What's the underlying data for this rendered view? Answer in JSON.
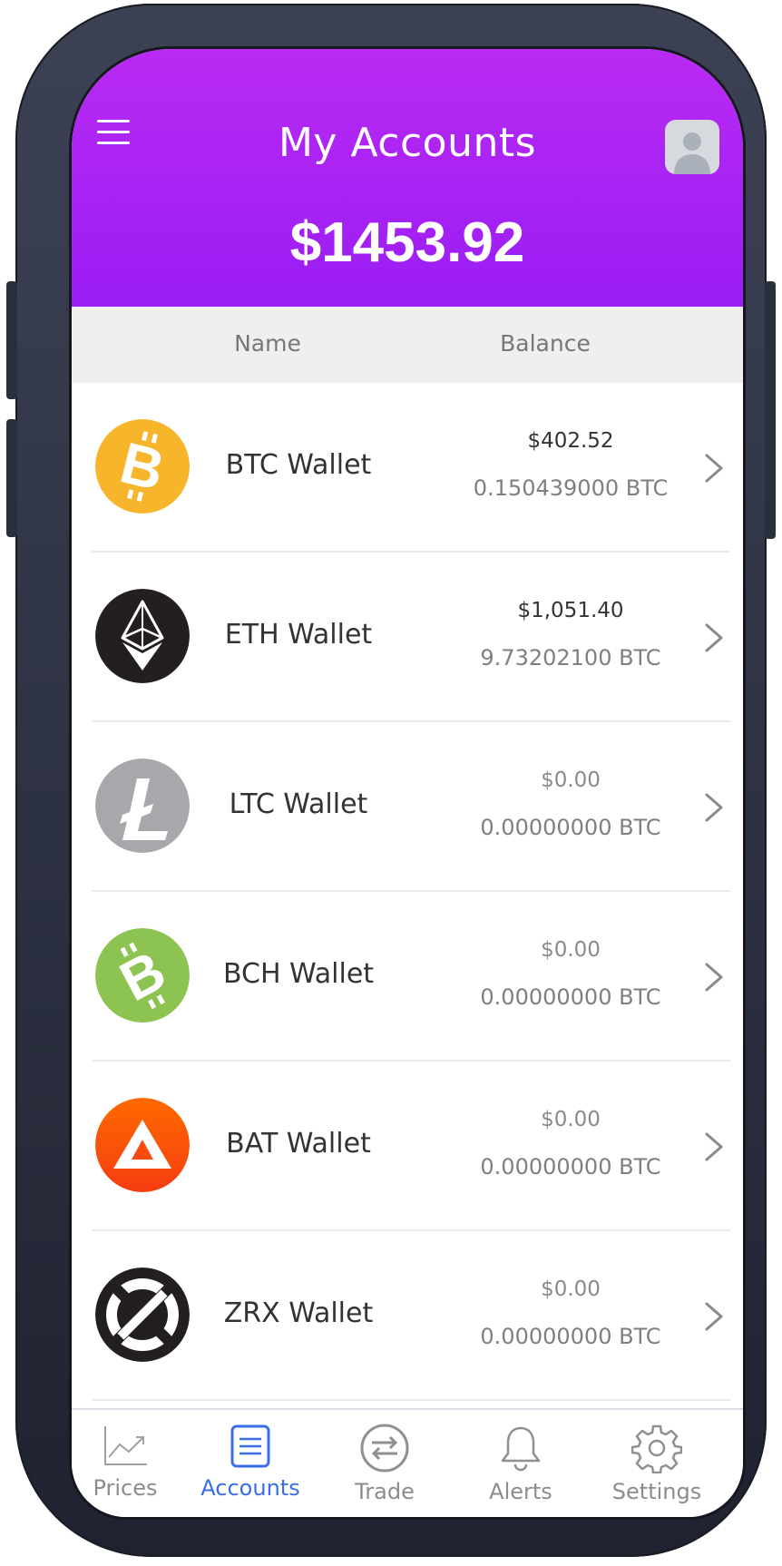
{
  "header": {
    "title": "My Accounts",
    "total": "$1453.92",
    "background_color": "#a822f4"
  },
  "columns": {
    "name": "Name",
    "balance": "Balance"
  },
  "wallets": [
    {
      "name": "BTC Wallet",
      "usd": "$402.52",
      "btc": "0.150439000 BTC",
      "icon": "bitcoin-icon",
      "color": "#f7b52c"
    },
    {
      "name": "ETH Wallet",
      "usd": "$1,051.40",
      "btc": "9.73202100 BTC",
      "icon": "ethereum-icon",
      "color": "#231f20"
    },
    {
      "name": "LTC Wallet",
      "usd": "$0.00",
      "btc": "0.00000000 BTC",
      "icon": "litecoin-icon",
      "color": "#a6a8ab"
    },
    {
      "name": "BCH Wallet",
      "usd": "$0.00",
      "btc": "0.00000000 BTC",
      "icon": "bitcoin-cash-icon",
      "color": "#8dc351"
    },
    {
      "name": "BAT Wallet",
      "usd": "$0.00",
      "btc": "0.00000000 BTC",
      "icon": "bat-icon",
      "color": "#ff5000"
    },
    {
      "name": "ZRX Wallet",
      "usd": "$0.00",
      "btc": "0.00000000 BTC",
      "icon": "zrx-icon",
      "color": "#231f20"
    }
  ],
  "tabs": [
    {
      "label": "Prices",
      "icon": "chart-icon",
      "active": false
    },
    {
      "label": "Accounts",
      "icon": "list-icon",
      "active": true
    },
    {
      "label": "Trade",
      "icon": "exchange-icon",
      "active": false
    },
    {
      "label": "Alerts",
      "icon": "bell-icon",
      "active": false
    },
    {
      "label": "Settings",
      "icon": "gear-icon",
      "active": false
    }
  ],
  "colors": {
    "active_tab": "#3a6ee8",
    "inactive_tab": "#8c8c8c"
  }
}
